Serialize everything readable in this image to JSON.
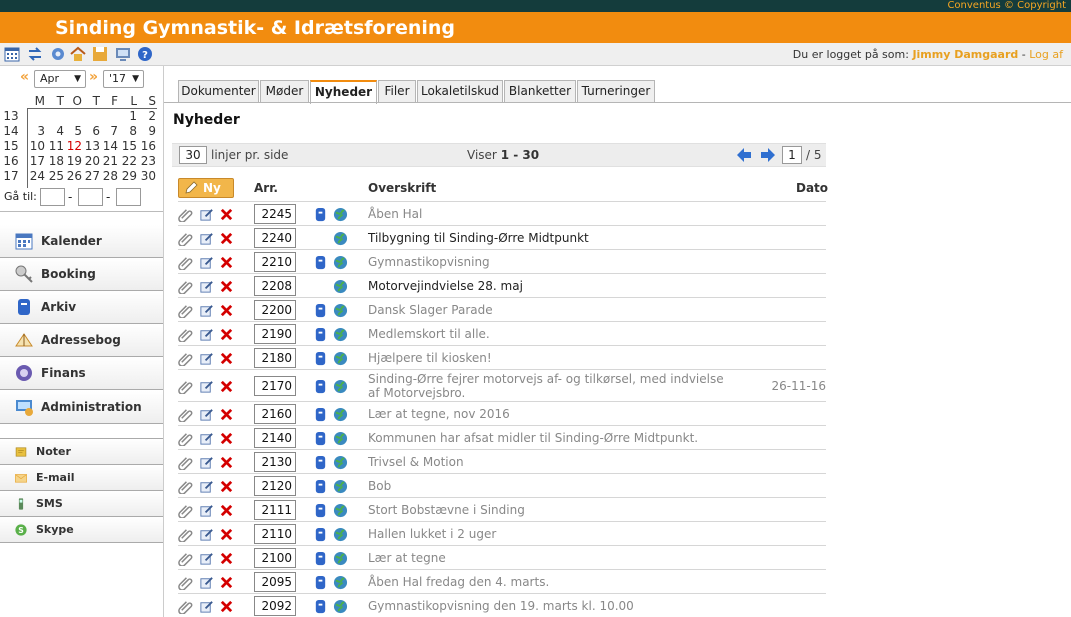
{
  "header": {
    "copyright": "Conventus © Copyright",
    "title": "Sinding Gymnastik- & Idrætsforening",
    "login_prefix": "Du er logget på som:",
    "user": "Jimmy Damgaard",
    "separator": " - ",
    "logout": "Log af"
  },
  "toolbar_icons": [
    "calendar-icon",
    "sync-icon",
    "settings-icon",
    "home-icon",
    "save-icon",
    "monitor-icon",
    "help-icon"
  ],
  "calendar": {
    "prev": "«",
    "next": "»",
    "month": "Apr",
    "year": "'17",
    "weekdays": [
      "M",
      "T",
      "O",
      "T",
      "F",
      "L",
      "S"
    ],
    "weeks": [
      {
        "week": "13",
        "days": [
          "",
          "",
          "",
          "",
          "",
          "1",
          "2"
        ]
      },
      {
        "week": "14",
        "days": [
          "3",
          "4",
          "5",
          "6",
          "7",
          "8",
          "9"
        ]
      },
      {
        "week": "15",
        "days": [
          "10",
          "11",
          "12",
          "13",
          "14",
          "15",
          "16"
        ]
      },
      {
        "week": "16",
        "days": [
          "17",
          "18",
          "19",
          "20",
          "21",
          "22",
          "23"
        ]
      },
      {
        "week": "17",
        "days": [
          "24",
          "25",
          "26",
          "27",
          "28",
          "29",
          "30"
        ]
      }
    ],
    "today": "12",
    "goto_label": "Gå til:"
  },
  "sidebar": {
    "modules": [
      {
        "label": "Kalender",
        "icon": "calendar-icon"
      },
      {
        "label": "Booking",
        "icon": "key-icon"
      },
      {
        "label": "Arkiv",
        "icon": "archive-icon"
      },
      {
        "label": "Adressebog",
        "icon": "address-book-icon"
      },
      {
        "label": "Finans",
        "icon": "finance-icon"
      },
      {
        "label": "Administration",
        "icon": "admin-icon"
      }
    ],
    "tools": [
      {
        "label": "Noter",
        "icon": "note-icon"
      },
      {
        "label": "E-mail",
        "icon": "email-icon"
      },
      {
        "label": "SMS",
        "icon": "phone-icon"
      },
      {
        "label": "Skype",
        "icon": "skype-icon"
      }
    ]
  },
  "tabs": [
    "Dokumenter",
    "Møder",
    "Nyheder",
    "Filer",
    "Lokaletilskud",
    "Blanketter",
    "Turneringer"
  ],
  "active_tab": "Nyheder",
  "page": {
    "heading": "Nyheder",
    "lines_per_page": "30",
    "lines_label": "linjer pr. side",
    "showing_prefix": "Viser",
    "showing_range": "1 - 30",
    "current_page": "1",
    "total_pages": "/ 5",
    "new_button": "Ny",
    "columns": {
      "arr": "Arr.",
      "title": "Overskrift",
      "date": "Dato"
    }
  },
  "news": [
    {
      "order": "2245",
      "title": "Åben Hal",
      "date": "",
      "archive": true,
      "muted": true
    },
    {
      "order": "2240",
      "title": "Tilbygning til Sinding-Ørre Midtpunkt",
      "date": "",
      "archive": false,
      "muted": false
    },
    {
      "order": "2210",
      "title": "Gymnastikopvisning",
      "date": "",
      "archive": true,
      "muted": true
    },
    {
      "order": "2208",
      "title": "Motorvejindvielse 28. maj",
      "date": "",
      "archive": false,
      "muted": false
    },
    {
      "order": "2200",
      "title": "Dansk Slager Parade",
      "date": "",
      "archive": true,
      "muted": true
    },
    {
      "order": "2190",
      "title": "Medlemskort til alle.",
      "date": "",
      "archive": true,
      "muted": true
    },
    {
      "order": "2180",
      "title": "Hjælpere til kiosken!",
      "date": "",
      "archive": true,
      "muted": true
    },
    {
      "order": "2170",
      "title": "Sinding-Ørre fejrer motorvejs af- og tilkørsel, med indvielse af Motorvejsbro.",
      "date": "26-11-16",
      "archive": true,
      "muted": true
    },
    {
      "order": "2160",
      "title": "Lær at tegne, nov 2016",
      "date": "",
      "archive": true,
      "muted": true
    },
    {
      "order": "2140",
      "title": "Kommunen har afsat midler til Sinding-Ørre Midtpunkt.",
      "date": "",
      "archive": true,
      "muted": true
    },
    {
      "order": "2130",
      "title": "Trivsel & Motion",
      "date": "",
      "archive": true,
      "muted": true
    },
    {
      "order": "2120",
      "title": "Bob",
      "date": "",
      "archive": true,
      "muted": true
    },
    {
      "order": "2111",
      "title": "Stort Bobstævne i Sinding",
      "date": "",
      "archive": true,
      "muted": true
    },
    {
      "order": "2110",
      "title": "Hallen lukket i 2 uger",
      "date": "",
      "archive": true,
      "muted": true
    },
    {
      "order": "2100",
      "title": "Lær at tegne",
      "date": "",
      "archive": true,
      "muted": true
    },
    {
      "order": "2095",
      "title": "Åben Hal fredag den 4. marts.",
      "date": "",
      "archive": true,
      "muted": true
    },
    {
      "order": "2092",
      "title": "Gymnastikopvisning den 19. marts kl. 10.00",
      "date": "",
      "archive": true,
      "muted": true
    }
  ],
  "colors": {
    "accent": "#f28c0f",
    "topstrip": "#143c3c",
    "link": "#e8a020",
    "delete": "#d40000",
    "globe": "#3a8ac0"
  }
}
